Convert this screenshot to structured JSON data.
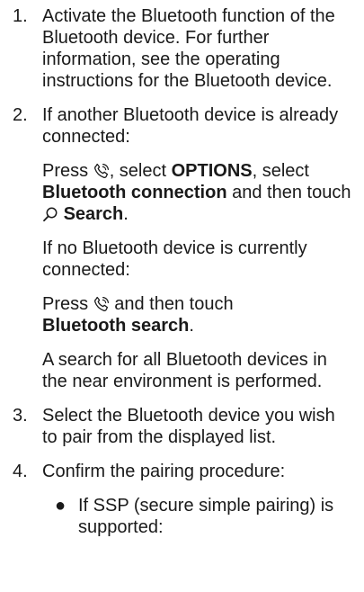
{
  "steps": {
    "s1": {
      "num": "1.",
      "text": "Activate the Bluetooth function of the Bluetooth device. For further information, see the operating instructions for the Bluetooth device."
    },
    "s2": {
      "num": "2.",
      "intro": "If another Bluetooth device is already connected:",
      "connected_press": "Press",
      "connected_select": ", select",
      "options": "OPTIONS",
      "connected_select2": ", select",
      "bt_connection": "Bluetooth connection",
      "connected_then": "and then touch",
      "search": "Search",
      "period": ".",
      "none_intro": "If no Bluetooth device is currently connected:",
      "none_press": "Press",
      "none_then": "and then touch",
      "bt_search": "Bluetooth search",
      "search_desc": "A search for all Bluetooth devices in the near environment is performed."
    },
    "s3": {
      "num": "3.",
      "text": "Select the Bluetooth device you wish to pair from the displayed list."
    },
    "s4": {
      "num": "4.",
      "text": "Confirm the pairing procedure:",
      "bullet_symbol": "●",
      "bullet1": "If SSP (secure simple pairing) is supported:"
    }
  },
  "icons": [
    "phone-icon",
    "search-icon"
  ]
}
